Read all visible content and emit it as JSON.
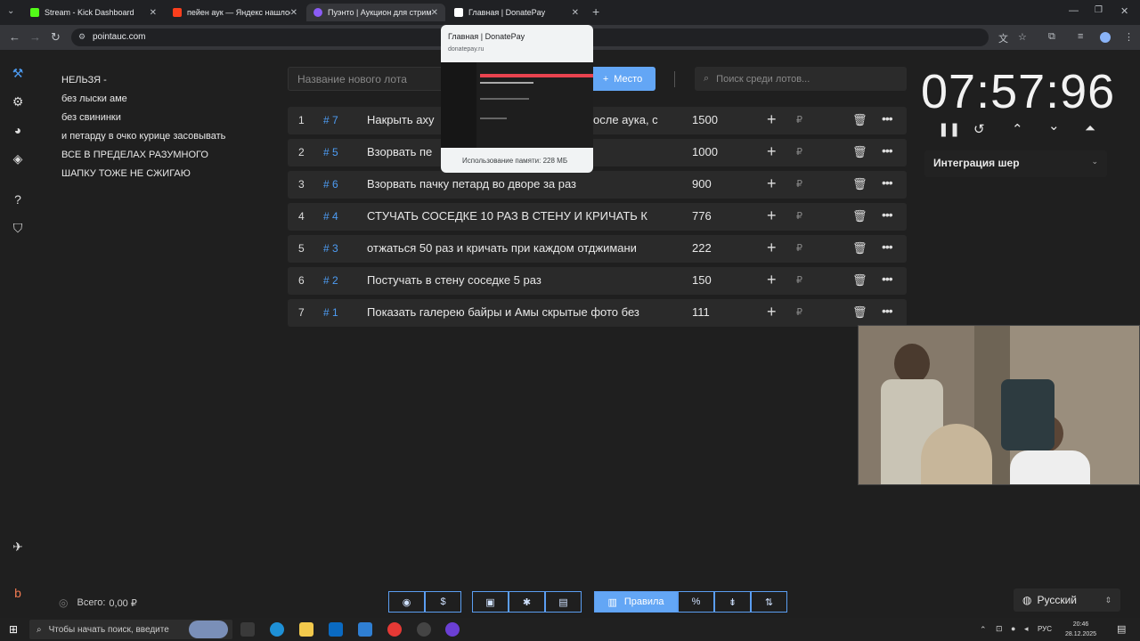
{
  "browser": {
    "tabs": [
      {
        "title": "Stream - Kick Dashboard",
        "favicon_color": "#53fc18"
      },
      {
        "title": "пейен аук — Яндекс нашлось",
        "favicon_color": "#fc3f1d"
      },
      {
        "title": "Пуэнто | Аукцион для стримеров",
        "favicon_color": "#8b5cf6"
      },
      {
        "title": "Главная | DonatePay",
        "favicon_color": "#ffffff"
      }
    ],
    "url": "pointauc.com",
    "preview": {
      "title": "Главная | DonatePay",
      "url": "donatepay.ru",
      "memory": "Использование памяти: 228 МБ"
    }
  },
  "notes": [
    "НЕЛЬЗЯ -",
    "без лыски аме",
    "без свининки",
    "и петарду в очко курице засовывать",
    "ВСЕ В ПРЕДЕЛАХ РАЗУМНОГО",
    "ШАПКУ ТОЖЕ НЕ СЖИГАЮ"
  ],
  "lot_input": {
    "placeholder": "Название нового лота"
  },
  "place_button": {
    "label": "Место",
    "icon": "plus-icon"
  },
  "search": {
    "placeholder": "Поиск среди лотов..."
  },
  "lots": [
    {
      "index": "1",
      "tag": "# 7",
      "name": "Накрыть аху",
      "name_tail": "осле аука, с",
      "amount": "1500"
    },
    {
      "index": "2",
      "tag": "# 5",
      "name": "Взорвать пе",
      "name_tail": "",
      "amount": "1000"
    },
    {
      "index": "3",
      "tag": "# 6",
      "name": "Взорвать пачку петард во дворе за раз",
      "name_tail": "",
      "amount": "900"
    },
    {
      "index": "4",
      "tag": "# 4",
      "name": "СТУЧАТЬ СОСЕДКЕ 10 РАЗ В СТЕНУ И КРИЧАТЬ К",
      "name_tail": "",
      "amount": "776"
    },
    {
      "index": "5",
      "tag": "# 3",
      "name": "отжаться 50 раз и кричать при каждом отджимани",
      "name_tail": "",
      "amount": "222"
    },
    {
      "index": "6",
      "tag": "# 2",
      "name": "Постучать в стену соседке 5 раз",
      "name_tail": "",
      "amount": "150"
    },
    {
      "index": "7",
      "tag": "# 1",
      "name": "Показать галерею байры и Амы скрытые фото без",
      "name_tail": "",
      "amount": "111"
    }
  ],
  "currency_symbol": "₽",
  "timer": {
    "value": "07:57:96"
  },
  "integration": {
    "label": "Интеграция шер"
  },
  "footer": {
    "total_label": "Всего:",
    "total_value": "0,00 ₽",
    "rules_label": "Правила",
    "percent_label": "%",
    "language": "Русский"
  },
  "taskbar": {
    "search_placeholder": "Чтобы начать поиск, введите",
    "lang": "РУС",
    "time": "20:46",
    "date": "28.12.2025"
  },
  "colors": {
    "accent": "#63a6f5",
    "tag": "#4d9cf3",
    "bg": "#1f1f1f",
    "row": "#2a2a2a"
  }
}
